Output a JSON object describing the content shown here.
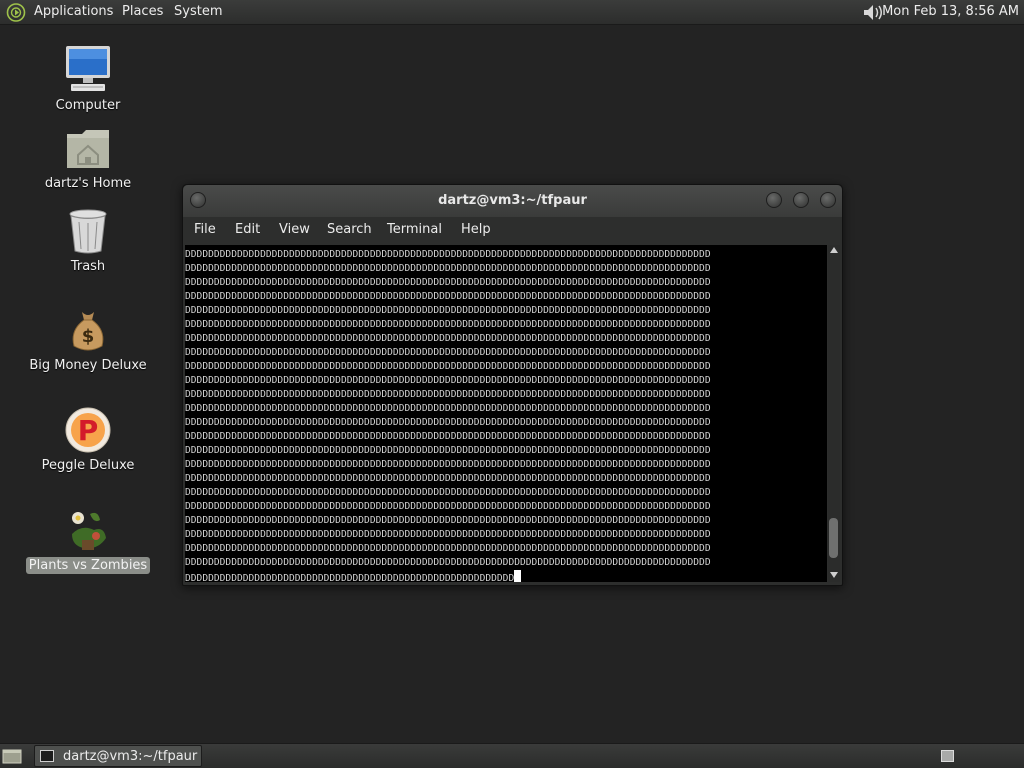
{
  "top_panel": {
    "menus": [
      "Applications",
      "Places",
      "System"
    ],
    "volume_icon": "speaker-icon",
    "clock": "Mon Feb 13,  8:56 AM"
  },
  "desktop": {
    "icons": [
      {
        "label": "Computer",
        "icon": "computer-icon"
      },
      {
        "label": "dartz's Home",
        "icon": "home-folder-icon"
      },
      {
        "label": "Trash",
        "icon": "trash-icon"
      },
      {
        "label": "Big Money Deluxe",
        "icon": "money-bag-icon"
      },
      {
        "label": "Peggle Deluxe",
        "icon": "peggle-icon"
      },
      {
        "label": "Plants vs Zombies",
        "icon": "plants-vs-zombies-icon",
        "selected": true
      }
    ]
  },
  "terminal": {
    "title": "dartz@vm3:~/tfpaur",
    "menu": [
      "File",
      "Edit",
      "View",
      "Search",
      "Terminal",
      "Help"
    ],
    "full_line": "DDDDDDDDDDDDDDDDDDDDDDDDDDDDDDDDDDDDDDDDDDDDDDDDDDDDDDDDDDDDDDDDDDDDDDDDDDDDDDDDDDDDDDDDDDD",
    "full_line_count": 23,
    "last_line": "DDDDDDDDDDDDDDDDDDDDDDDDDDDDDDDDDDDDDDDDDDDDDDDDDDDDDDDDD",
    "scroll_position": 0.95
  },
  "bottom_panel": {
    "task": "dartz@vm3:~/tfpaur"
  },
  "colors": {
    "desktop_bg": "#232323",
    "panel_bg": "#2f302f",
    "terminal_bg": "#000000",
    "terminal_fg": "#d0d0d0"
  }
}
